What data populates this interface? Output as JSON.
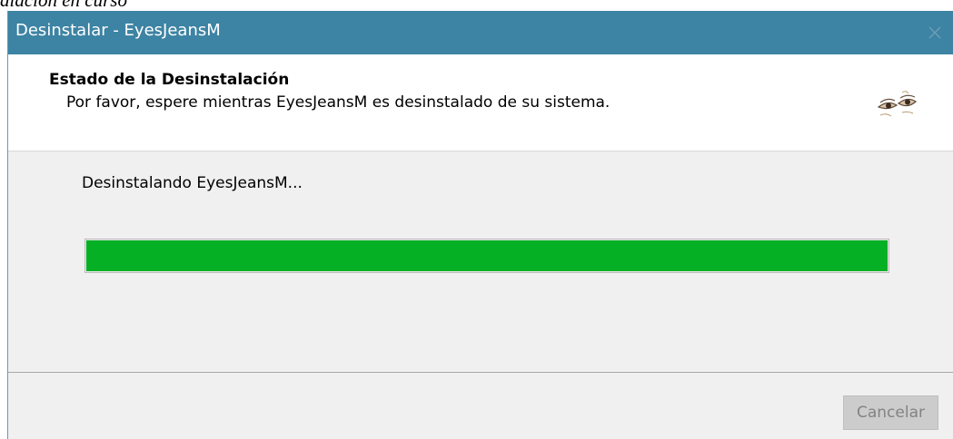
{
  "caption": {
    "text": "alación en curso"
  },
  "window": {
    "title": "Desinstalar - EyesJeansM",
    "close_icon": "close-icon"
  },
  "header": {
    "title": "Estado de la Desinstalación",
    "subtitle": "Por favor, espere mientras EyesJeansM es desinstalado de su sistema.",
    "logo_icon": "eyes-logo-icon"
  },
  "body": {
    "status": "Desinstalando EyesJeansM..."
  },
  "progress": {
    "value": 1.0,
    "color": "#06b025"
  },
  "footer": {
    "cancel_label": "Cancelar",
    "cancel_enabled": false
  },
  "colors": {
    "titlebar": "#3d83a3",
    "window_bg": "#f0f0f0",
    "header_bg": "#ffffff"
  }
}
